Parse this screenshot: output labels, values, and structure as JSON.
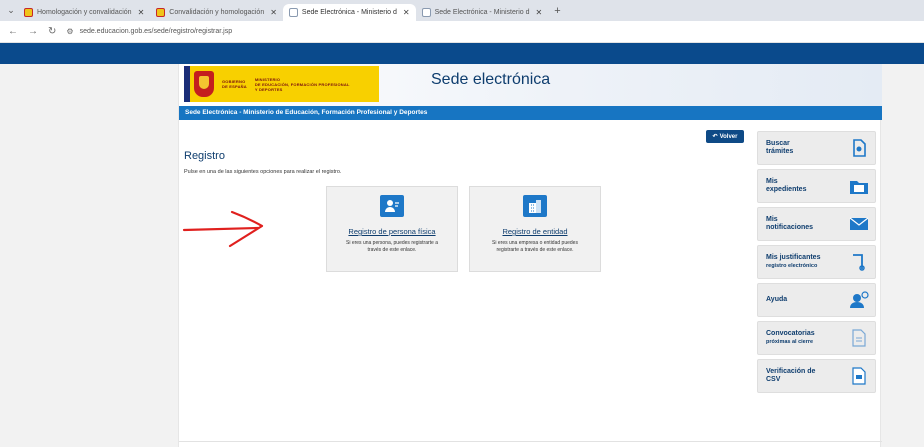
{
  "browser": {
    "tabs": [
      {
        "label": "Homologación y convalidación",
        "fav": "yellow"
      },
      {
        "label": "Convalidación y homologación",
        "fav": "yellow"
      },
      {
        "label": "Sede Electrónica - Ministerio d",
        "fav": "gray",
        "active": true
      },
      {
        "label": "Sede Electrónica - Ministerio d",
        "fav": "gray"
      }
    ],
    "url": "sede.educacion.gob.es/sede/registro/registrar.jsp"
  },
  "header": {
    "gobierno_lines": [
      "GOBIERNO",
      "DE ESPAÑA"
    ],
    "ministerio_lines": [
      "MINISTERIO",
      "DE EDUCACIÓN, FORMACIÓN PROFESIONAL",
      "Y DEPORTES"
    ],
    "sede_title": "Sede electrónica"
  },
  "ministry_bar": "Sede Electrónica - Ministerio de Educación, Formación Profesional y Deportes",
  "back_label": "Volver",
  "main": {
    "title": "Registro",
    "description": "Pulse en una de las siguientes opciones para realizar el registro.",
    "cards": [
      {
        "title": "Registro de persona física",
        "text": "Si eres una persona, puedes registrarte a través de este enlace."
      },
      {
        "title": "Registro de entidad",
        "text": "Si eres una empresa o entidad puedes registrarte a través de este enlace."
      }
    ]
  },
  "sidebar": {
    "items": [
      {
        "label": "Buscar\ntrámites",
        "icon": "document-search-icon"
      },
      {
        "label": "Mis\nexpedientes",
        "icon": "folder-icon"
      },
      {
        "label": "Mis\nnotificaciones",
        "icon": "envelope-icon"
      },
      {
        "label": "Mis justificantes",
        "sub": "registro electrónico",
        "icon": "receipt-icon"
      },
      {
        "label": "Ayuda",
        "icon": "help-icon"
      },
      {
        "label": "Convocatorias",
        "sub": "próximas al cierre",
        "icon": "calendar-doc-icon"
      },
      {
        "label": "Verificación de\nCSV",
        "icon": "csv-doc-icon"
      }
    ]
  },
  "colors": {
    "primary": "#0e3d6e",
    "bar_blue": "#1775c2",
    "top_strip": "#0a4a8c",
    "annotation_red": "#e0201e"
  }
}
